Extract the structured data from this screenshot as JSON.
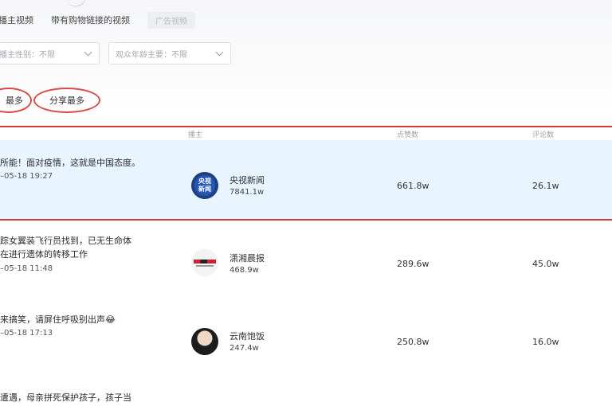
{
  "tabs": [
    "播主视频",
    "带有购物链接的视频",
    "广告视频"
  ],
  "filters": [
    {
      "label": "播主性别：不限"
    },
    {
      "label": "观众年龄主要：不限"
    }
  ],
  "sort_buttons": [
    "最多",
    "分享最多"
  ],
  "table": {
    "headers": {
      "author": "播主",
      "plays": "点赞数",
      "comments": "评论数"
    },
    "rows": [
      {
        "title": "所能！面对疫情，这就是中国态度。",
        "date": "–05-18 19:27",
        "author": "央视新闻",
        "fans": "7841.1w",
        "plays": "661.8w",
        "comments": "26.1w",
        "avatar": "cctv-news-logo"
      },
      {
        "title": "踪女翼装飞行员找到，已无生命体\n在进行遗体的转移工作",
        "date": "–05-18 11:48",
        "author": "潇湘晨报",
        "fans": "468.9w",
        "plays": "289.6w",
        "comments": "45.0w",
        "avatar": "xiaoxiang-chenbao-logo"
      },
      {
        "title": "来搞笑，请屏住呼吸别出声😂",
        "date": "–05-18 17:13",
        "author": "云南饱饭",
        "fans": "247.4w",
        "plays": "250.8w",
        "comments": "16.0w",
        "avatar": "user-portrait"
      },
      {
        "title": "遭遇，母亲拼死保护孩子，孩子当",
        "date": "",
        "author": "",
        "fans": "",
        "plays": "",
        "comments": "",
        "avatar": ""
      }
    ]
  },
  "avatar_text": {
    "cctv": "央视\n新闻"
  },
  "colors": {
    "highlight": "#d23c3c",
    "selected_row": "#e8f4fe",
    "annotation": "#d94b4b"
  }
}
